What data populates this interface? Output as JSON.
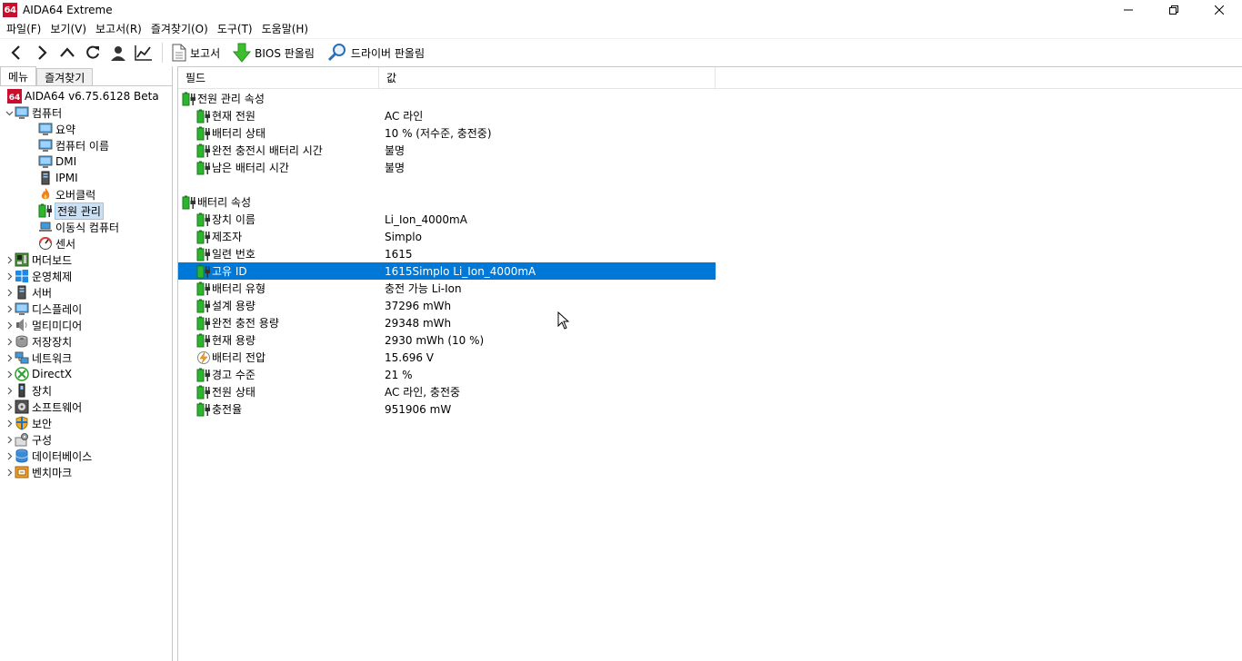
{
  "window": {
    "title": "AIDA64 Extreme",
    "logo_text": "64",
    "minimize": "—",
    "restore": "❐",
    "close": "✕"
  },
  "menu": [
    {
      "label": "파일(F)"
    },
    {
      "label": "보기(V)"
    },
    {
      "label": "보고서(R)"
    },
    {
      "label": "즐겨찾기(O)"
    },
    {
      "label": "도구(T)"
    },
    {
      "label": "도움말(H)"
    }
  ],
  "toolbar": {
    "report_label": "보고서",
    "bios_label": "BIOS 판올림",
    "driver_label": "드라이버 판올림"
  },
  "left": {
    "tabs": [
      {
        "label": "메뉴"
      },
      {
        "label": "즐겨찾기"
      }
    ],
    "tree": [
      {
        "label": "AIDA64 v6.75.6128 Beta",
        "indent": 0,
        "exp": "",
        "icon": "aida-icon",
        "selected": false
      },
      {
        "label": "컴퓨터",
        "indent": 0,
        "exp": "v",
        "icon": "computer-icon",
        "selected": false
      },
      {
        "label": "요약",
        "indent": 2,
        "exp": "",
        "icon": "monitor-icon",
        "selected": false
      },
      {
        "label": "컴퓨터 이름",
        "indent": 2,
        "exp": "",
        "icon": "monitor-icon",
        "selected": false
      },
      {
        "label": "DMI",
        "indent": 2,
        "exp": "",
        "icon": "monitor-icon",
        "selected": false
      },
      {
        "label": "IPMI",
        "indent": 2,
        "exp": "",
        "icon": "server-icon",
        "selected": false
      },
      {
        "label": "오버클럭",
        "indent": 2,
        "exp": "",
        "icon": "flame-icon",
        "selected": false
      },
      {
        "label": "전원 관리",
        "indent": 2,
        "exp": "",
        "icon": "battery-plug-icon",
        "selected": true
      },
      {
        "label": "이동식 컴퓨터",
        "indent": 2,
        "exp": "",
        "icon": "laptop-icon",
        "selected": false
      },
      {
        "label": "센서",
        "indent": 2,
        "exp": "",
        "icon": "gauge-icon",
        "selected": false
      },
      {
        "label": "머더보드",
        "indent": 0,
        "exp": ">",
        "icon": "motherboard-icon",
        "selected": false
      },
      {
        "label": "운영체제",
        "indent": 0,
        "exp": ">",
        "icon": "windows-icon",
        "selected": false
      },
      {
        "label": "서버",
        "indent": 0,
        "exp": ">",
        "icon": "server-icon",
        "selected": false
      },
      {
        "label": "디스플레이",
        "indent": 0,
        "exp": ">",
        "icon": "monitor-icon",
        "selected": false
      },
      {
        "label": "멀티미디어",
        "indent": 0,
        "exp": ">",
        "icon": "speaker-icon",
        "selected": false
      },
      {
        "label": "저장장치",
        "indent": 0,
        "exp": ">",
        "icon": "disk-icon",
        "selected": false
      },
      {
        "label": "네트워크",
        "indent": 0,
        "exp": ">",
        "icon": "network-icon",
        "selected": false
      },
      {
        "label": "DirectX",
        "indent": 0,
        "exp": ">",
        "icon": "xbox-icon",
        "selected": false
      },
      {
        "label": "장치",
        "indent": 0,
        "exp": ">",
        "icon": "device-icon",
        "selected": false
      },
      {
        "label": "소프트웨어",
        "indent": 0,
        "exp": ">",
        "icon": "software-icon",
        "selected": false
      },
      {
        "label": "보안",
        "indent": 0,
        "exp": ">",
        "icon": "shield-icon",
        "selected": false
      },
      {
        "label": "구성",
        "indent": 0,
        "exp": ">",
        "icon": "config-icon",
        "selected": false
      },
      {
        "label": "데이터베이스",
        "indent": 0,
        "exp": ">",
        "icon": "database-icon",
        "selected": false
      },
      {
        "label": "벤치마크",
        "indent": 0,
        "exp": ">",
        "icon": "benchmark-icon",
        "selected": false
      }
    ]
  },
  "table": {
    "headers": {
      "field": "필드",
      "value": "값"
    },
    "sections": [
      {
        "title": "전원 관리 속성",
        "items": [
          {
            "field": "현재 전원",
            "value": "AC 라인",
            "icon": "battery-plug-icon",
            "selected": false
          },
          {
            "field": "배터리 상태",
            "value": "10 % (저수준, 충전중)",
            "icon": "battery-plug-icon",
            "selected": false
          },
          {
            "field": "완전 충전시 배터리 시간",
            "value": "불명",
            "icon": "battery-plug-icon",
            "selected": false
          },
          {
            "field": "남은 배터리 시간",
            "value": "불명",
            "icon": "battery-plug-icon",
            "selected": false
          }
        ]
      },
      {
        "title": "배터리 속성",
        "items": [
          {
            "field": "장치 이름",
            "value": "Li_Ion_4000mA",
            "icon": "battery-plug-icon",
            "selected": false
          },
          {
            "field": "제조자",
            "value": "Simplo",
            "icon": "battery-plug-icon",
            "selected": false
          },
          {
            "field": "일련 번호",
            "value": "1615",
            "icon": "battery-plug-icon",
            "selected": false
          },
          {
            "field": "고유 ID",
            "value": "1615Simplo Li_Ion_4000mA",
            "icon": "battery-plug-icon",
            "selected": true
          },
          {
            "field": "배터리 유형",
            "value": "충전 가능 Li-Ion",
            "icon": "battery-plug-icon",
            "selected": false
          },
          {
            "field": "설계 용량",
            "value": "37296 mWh",
            "icon": "battery-plug-icon",
            "selected": false
          },
          {
            "field": "완전 충전 용량",
            "value": "29348 mWh",
            "icon": "battery-plug-icon",
            "selected": false
          },
          {
            "field": "현재 용량",
            "value": "2930 mWh  (10 %)",
            "icon": "battery-plug-icon",
            "selected": false
          },
          {
            "field": "배터리 전압",
            "value": "15.696 V",
            "icon": "voltage-icon",
            "selected": false
          },
          {
            "field": "경고 수준",
            "value": "21 %",
            "icon": "battery-plug-icon",
            "selected": false
          },
          {
            "field": "전원 상태",
            "value": "AC 라인, 충전중",
            "icon": "battery-plug-icon",
            "selected": false
          },
          {
            "field": "충전율",
            "value": "951906 mW",
            "icon": "battery-plug-icon",
            "selected": false
          }
        ]
      }
    ]
  },
  "colors": {
    "selection": "#0078d7",
    "battery_green": "#2db52d",
    "logo_red": "#c8102e"
  }
}
